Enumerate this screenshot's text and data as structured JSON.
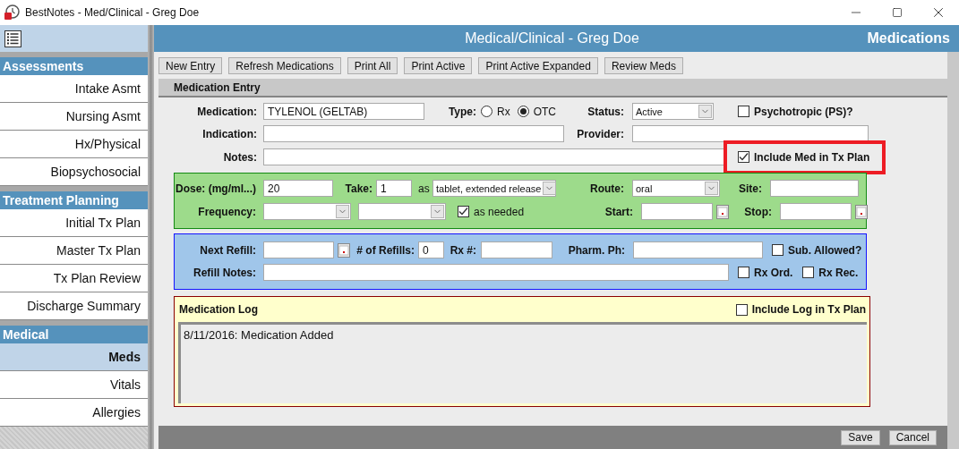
{
  "window": {
    "title": "BestNotes - Med/Clinical - Greg Doe"
  },
  "sidebar": {
    "sections": [
      {
        "title": "Assessments",
        "items": [
          {
            "label": "Intake Asmt",
            "selected": false
          },
          {
            "label": "Nursing Asmt",
            "selected": false
          },
          {
            "label": "Hx/Physical",
            "selected": false
          },
          {
            "label": "Biopsychosocial",
            "selected": false
          }
        ]
      },
      {
        "title": "Treatment Planning",
        "items": [
          {
            "label": "Initial Tx Plan",
            "selected": false
          },
          {
            "label": "Master Tx Plan",
            "selected": false
          },
          {
            "label": "Tx Plan Review",
            "selected": false
          },
          {
            "label": "Discharge Summary",
            "selected": false
          }
        ]
      },
      {
        "title": "Medical",
        "items": [
          {
            "label": "Meds",
            "selected": true
          },
          {
            "label": "Vitals",
            "selected": false
          },
          {
            "label": "Allergies",
            "selected": false
          }
        ]
      }
    ]
  },
  "header": {
    "title": "Medical/Clinical - Greg Doe",
    "page": "Medications"
  },
  "toolbar": [
    "New Entry",
    "Refresh Medications",
    "Print All",
    "Print Active",
    "Print Active Expanded",
    "Review Meds"
  ],
  "entry": {
    "title": "Medication Entry",
    "medication": {
      "label": "Medication:",
      "value": "TYLENOL (GELTAB)"
    },
    "type": {
      "label": "Type:",
      "options": [
        {
          "label": "Rx",
          "selected": false
        },
        {
          "label": "OTC",
          "selected": true
        }
      ]
    },
    "status": {
      "label": "Status:",
      "value": "Active"
    },
    "psychotropic": {
      "label": "Psychotropic (PS)?",
      "checked": false
    },
    "indication": {
      "label": "Indication:"
    },
    "provider": {
      "label": "Provider:"
    },
    "notes": {
      "label": "Notes:"
    },
    "include_med": {
      "label": "Include Med in Tx Plan",
      "checked": true,
      "highlighted": true
    }
  },
  "dosage": {
    "dose": {
      "label": "Dose: (mg/ml...)",
      "value": "20"
    },
    "take": {
      "label": "Take:",
      "value": "1"
    },
    "as_label": "as",
    "form": {
      "value": "tablet, extended release"
    },
    "route": {
      "label": "Route:",
      "value": "oral"
    },
    "site": {
      "label": "Site:"
    },
    "frequency": {
      "label": "Frequency:"
    },
    "as_needed": {
      "label": "as needed",
      "checked": true
    },
    "start": {
      "label": "Start:"
    },
    "stop": {
      "label": "Stop:"
    }
  },
  "refill": {
    "next_refill": {
      "label": "Next Refill:"
    },
    "refills": {
      "label": "# of Refills:",
      "value": "0"
    },
    "rx_number": {
      "label": "Rx #:"
    },
    "pharm_phone": {
      "label": "Pharm. Ph:"
    },
    "sub_allowed": {
      "label": "Sub. Allowed?",
      "checked": false
    },
    "refill_notes": {
      "label": "Refill Notes:"
    },
    "rx_ordered": {
      "label": "Rx Ord.",
      "checked": false
    },
    "rx_received": {
      "label": "Rx Rec.",
      "checked": false
    }
  },
  "log": {
    "title": "Medication Log",
    "include": {
      "label": "Include Log in Tx Plan",
      "checked": false
    },
    "entries": [
      "8/11/2016: Medication Added"
    ]
  },
  "footer": {
    "buttons": [
      "Save",
      "Cancel"
    ]
  }
}
